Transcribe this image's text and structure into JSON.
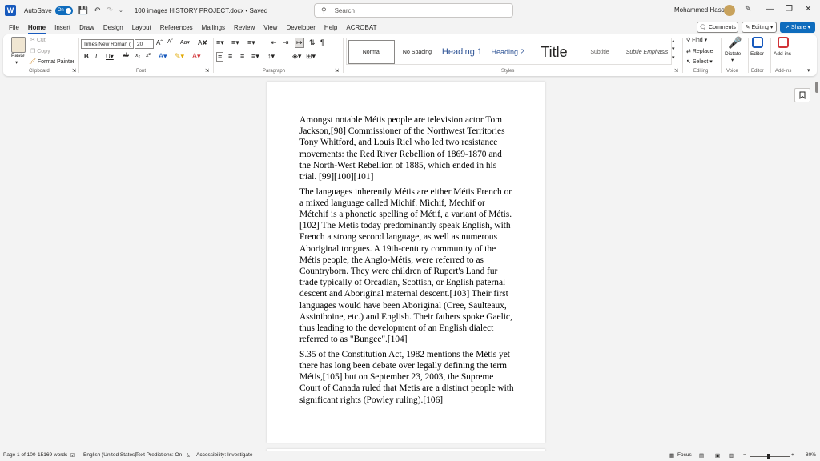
{
  "titlebar": {
    "autosave_label": "AutoSave",
    "autosave_state": "On",
    "document_title": "100 images HISTORY PROJECT.docx • Saved",
    "search_placeholder": "Search",
    "user_name": "Mohammed Hassbo"
  },
  "menu": {
    "tabs": [
      "File",
      "Home",
      "Insert",
      "Draw",
      "Design",
      "Layout",
      "References",
      "Mailings",
      "Review",
      "View",
      "Developer",
      "Help",
      "ACROBAT"
    ],
    "active_tab": "Home",
    "comments_label": "Comments",
    "editing_label": "Editing",
    "share_label": "Share"
  },
  "ribbon": {
    "clipboard": {
      "paste": "Paste",
      "cut": "Cut",
      "copy": "Copy",
      "format_painter": "Format Painter",
      "label": "Clipboard"
    },
    "font": {
      "font_name": "Times New Roman (",
      "font_size": "20",
      "label": "Font"
    },
    "paragraph": {
      "label": "Paragraph"
    },
    "styles": {
      "items": [
        "Normal",
        "No Spacing",
        "Heading 1",
        "Heading 2",
        "Title",
        "Subtitle",
        "Subtle Emphasis"
      ],
      "label": "Styles"
    },
    "editing": {
      "find": "Find",
      "replace": "Replace",
      "select": "Select",
      "label": "Editing"
    },
    "voice": {
      "dictate": "Dictate",
      "label": "Voice"
    },
    "editor": {
      "editor": "Editor",
      "label": "Editor"
    },
    "addins": {
      "addins": "Add-ins",
      "label": "Add-ins"
    }
  },
  "document": {
    "paragraphs": [
      "Amongst notable Métis people are television actor Tom Jackson,[98] Commissioner of the Northwest Territories Tony Whitford, and Louis Riel who led two resistance movements: the Red River Rebellion of 1869-1870 and the North-West Rebellion of 1885, which ended in his trial. [99][100][101]",
      "The languages inherently Métis are either Métis French or a mixed language called Michif. Michif, Mechif or Métchif is a phonetic spelling of Métif, a variant of Métis.[102] The Métis today predominantly speak English, with French a strong second language, as well as numerous Aboriginal tongues. A 19th-century community of the Métis people, the Anglo-Métis, were referred to as Countryborn. They were children of Rupert's Land fur trade typically of Orcadian, Scottish, or English paternal descent and Aboriginal maternal descent.[103] Their first languages would have been Aboriginal (Cree, Saulteaux, Assiniboine, etc.) and English. Their fathers spoke Gaelic, thus leading to the development of an English dialect referred to as \"Bungee\".[104]",
      "S.35 of the Constitution Act, 1982 mentions the Métis yet there has long been debate over legally defining the term Métis,[105] but on September 23, 2003, the Supreme Court of Canada ruled that Metis are a distinct people with significant rights (Powley ruling).[106]"
    ]
  },
  "statusbar": {
    "page": "Page 1 of 100",
    "words": "15169 words",
    "language": "English (United States)",
    "text_predictions": "Text Predictions: On",
    "accessibility": "Accessibility: Investigate",
    "focus": "Focus",
    "zoom": "80%"
  },
  "colors": {
    "accent": "#185abd",
    "share": "#0f6cbd",
    "heading": "#2f5496"
  }
}
